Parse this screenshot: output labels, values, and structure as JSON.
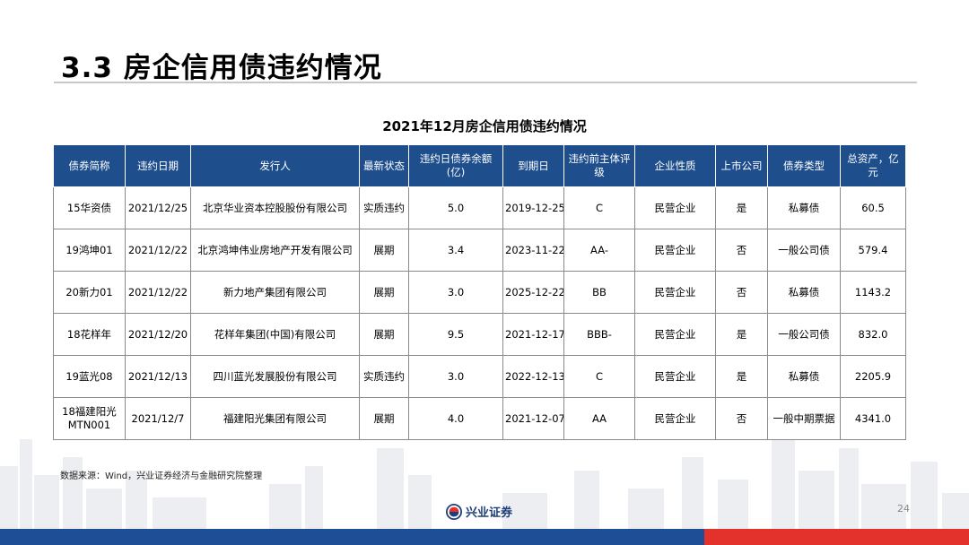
{
  "slide": {
    "title": "3.3 房企信用债违约情况",
    "page_number": "24"
  },
  "table": {
    "caption": "2021年12月房企信用债违约情况",
    "headers": [
      "债券简称",
      "违约日期",
      "发行人",
      "最新状态",
      "违约日债券余额(亿)",
      "到期日",
      "违约前主体评级",
      "企业性质",
      "上市公司",
      "债券类型",
      "总资产，亿元"
    ],
    "rows": [
      [
        "15华资债",
        "2021/12/25",
        "北京华业资本控股股份有限公司",
        "实质违约",
        "5.0",
        "2019-12-25",
        "C",
        "民营企业",
        "是",
        "私募债",
        "60.5"
      ],
      [
        "19鸿坤01",
        "2021/12/22",
        "北京鸿坤伟业房地产开发有限公司",
        "展期",
        "3.4",
        "2023-11-22",
        "AA-",
        "民营企业",
        "否",
        "一般公司债",
        "579.4"
      ],
      [
        "20新力01",
        "2021/12/22",
        "新力地产集团有限公司",
        "展期",
        "3.0",
        "2025-12-22",
        "BB",
        "民营企业",
        "否",
        "私募债",
        "1143.2"
      ],
      [
        "18花样年",
        "2021/12/20",
        "花样年集团(中国)有限公司",
        "展期",
        "9.5",
        "2021-12-17",
        "BBB-",
        "民营企业",
        "是",
        "一般公司债",
        "832.0"
      ],
      [
        "19蓝光08",
        "2021/12/13",
        "四川蓝光发展股份有限公司",
        "实质违约",
        "3.0",
        "2022-12-13",
        "C",
        "民营企业",
        "是",
        "私募债",
        "2205.9"
      ],
      [
        "18福建阳光MTN001",
        "2021/12/7",
        "福建阳光集团有限公司",
        "展期",
        "4.0",
        "2021-12-07",
        "AA",
        "民营企业",
        "否",
        "一般中期票据",
        "4341.0"
      ]
    ]
  },
  "source": "数据来源：Wind，兴业证券经济与金融研究院整理",
  "footer": {
    "logo_text": "兴业证券",
    "logo_icon": "company-logo-icon"
  },
  "colors": {
    "header_bg": "#1f4e8c",
    "bar_blue": "#1e4f96",
    "bar_red": "#e2322b"
  }
}
